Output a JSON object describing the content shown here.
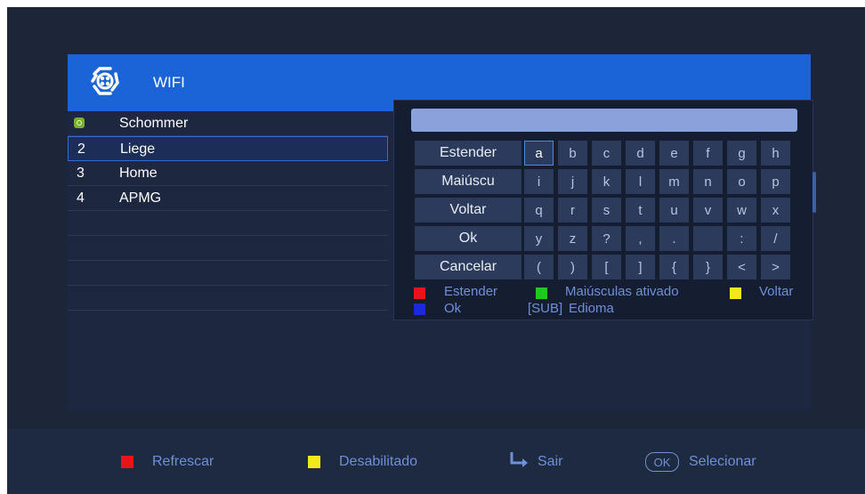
{
  "header": {
    "title": "WIFI"
  },
  "networks": [
    {
      "num": "",
      "name": "Schommer",
      "locked": true
    },
    {
      "num": "2",
      "name": "Liege"
    },
    {
      "num": "3",
      "name": "Home"
    },
    {
      "num": "4",
      "name": "APMG"
    }
  ],
  "keyboard": {
    "input_value": "",
    "functions": [
      "Estender",
      "Maiúscu",
      "Voltar",
      "Ok",
      "Cancelar"
    ],
    "rows": [
      [
        "a",
        "b",
        "c",
        "d",
        "e",
        "f",
        "g",
        "h"
      ],
      [
        "i",
        "j",
        "k",
        "l",
        "m",
        "n",
        "o",
        "p"
      ],
      [
        "q",
        "r",
        "s",
        "t",
        "u",
        "v",
        "w",
        "x"
      ],
      [
        "y",
        "z",
        "?",
        ",",
        ".",
        "",
        ":",
        "/"
      ],
      [
        "(",
        ")",
        "[",
        "]",
        "{",
        "}",
        "<",
        ">"
      ]
    ],
    "legend": {
      "red": "Estender",
      "green": "Maiúsculas ativado",
      "yellow": "Voltar",
      "blue": "Ok",
      "sub": "[SUB]",
      "language": "Edioma"
    }
  },
  "footer": {
    "refresh": "Refrescar",
    "disabled": "Desabilitado",
    "exit": "Sair",
    "ok_badge": "OK",
    "select": "Selecionar"
  },
  "colors": {
    "red": "#e8141c",
    "green": "#22c822",
    "yellow": "#f2e81a",
    "blue": "#1a2ad8",
    "header_blue": "#1a64d8"
  }
}
